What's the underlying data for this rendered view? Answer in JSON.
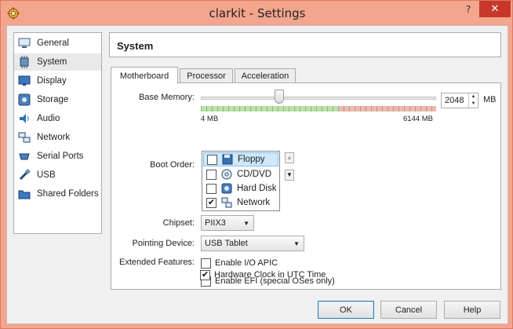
{
  "window": {
    "title": "clarkit - Settings",
    "help_glyph": "?",
    "close_glyph": "✕"
  },
  "sidebar": {
    "items": [
      {
        "label": "General",
        "icon": "monitor-icon"
      },
      {
        "label": "System",
        "icon": "chip-icon",
        "selected": true
      },
      {
        "label": "Display",
        "icon": "display-icon"
      },
      {
        "label": "Storage",
        "icon": "disk-icon"
      },
      {
        "label": "Audio",
        "icon": "speaker-icon"
      },
      {
        "label": "Network",
        "icon": "network-icon"
      },
      {
        "label": "Serial Ports",
        "icon": "serial-port-icon"
      },
      {
        "label": "USB",
        "icon": "usb-icon"
      },
      {
        "label": "Shared Folders",
        "icon": "folder-icon"
      }
    ]
  },
  "header": {
    "title": "System"
  },
  "tabs": [
    {
      "label": "Motherboard",
      "active": true
    },
    {
      "label": "Processor"
    },
    {
      "label": "Acceleration"
    }
  ],
  "motherboard": {
    "base_memory_label": "Base Memory:",
    "memory_value": "2048",
    "memory_unit": "MB",
    "memory_min_label": "4 MB",
    "memory_max_label": "6144 MB",
    "memory_fraction": 0.333,
    "boot_order_label": "Boot Order:",
    "boot_items": [
      {
        "label": "Floppy",
        "checked": false,
        "icon": "floppy-icon",
        "selected": true
      },
      {
        "label": "CD/DVD",
        "checked": false,
        "icon": "cd-icon"
      },
      {
        "label": "Hard Disk",
        "checked": false,
        "icon": "hard-disk-icon"
      },
      {
        "label": "Network",
        "checked": true,
        "icon": "network-icon"
      }
    ],
    "chipset_label": "Chipset:",
    "chipset_value": "PIIX3",
    "pointing_label": "Pointing Device:",
    "pointing_value": "USB Tablet",
    "extended_label": "Extended Features:",
    "features": [
      {
        "label": "Enable I/O APIC",
        "checked": false
      },
      {
        "label": "Enable EFI (special OSes only)",
        "checked": false
      },
      {
        "label": "Hardware Clock in UTC Time",
        "checked": true
      }
    ]
  },
  "buttons": {
    "ok": "OK",
    "cancel": "Cancel",
    "help": "Help"
  },
  "colors": {
    "titlebar": "#f4a58e",
    "close": "#c7382b",
    "slider_green": "#b9e4a6",
    "slider_red": "#f4b7ad"
  }
}
